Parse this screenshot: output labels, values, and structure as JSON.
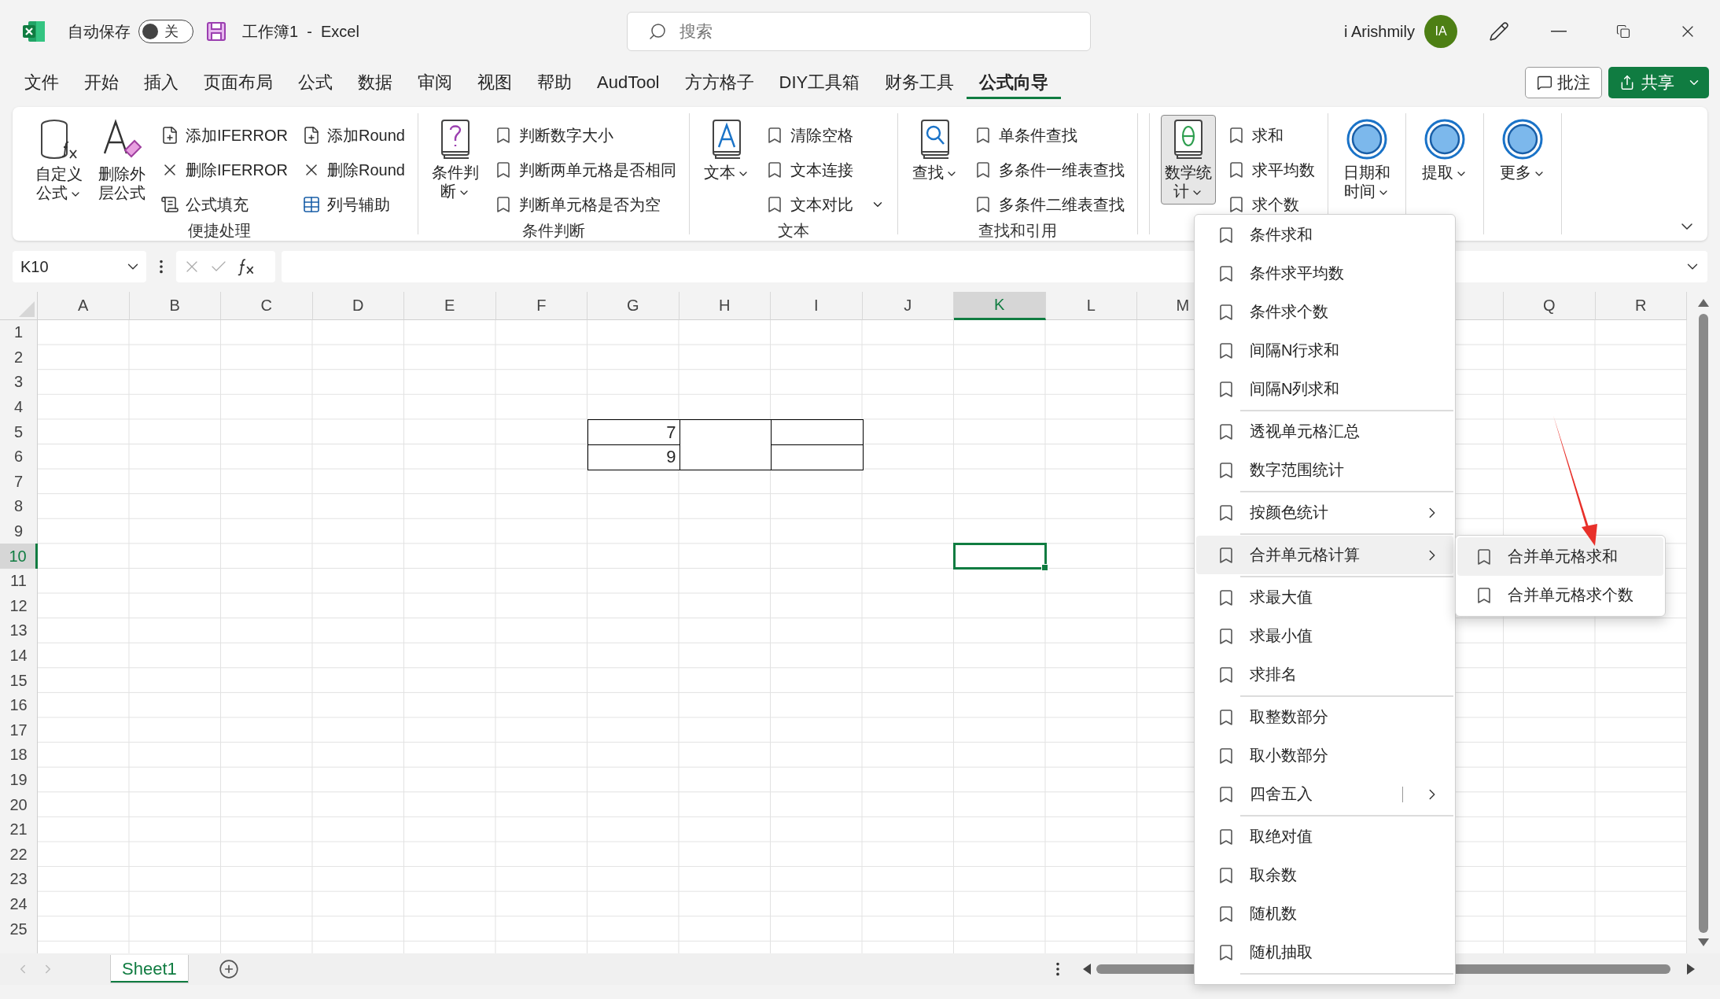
{
  "title_bar": {
    "autosave_label": "自动保存",
    "autosave_toggle": {
      "on": false,
      "label": "关"
    },
    "document_title": "工作簿1  -  Excel",
    "search": {
      "placeholder": "搜索"
    },
    "user_name": "i Arishmily",
    "avatar": "IA"
  },
  "menu_tabs": [
    {
      "label": "文件",
      "selected": false
    },
    {
      "label": "开始",
      "selected": false
    },
    {
      "label": "插入",
      "selected": false
    },
    {
      "label": "页面布局",
      "selected": false
    },
    {
      "label": "公式",
      "selected": false
    },
    {
      "label": "数据",
      "selected": false
    },
    {
      "label": "审阅",
      "selected": false
    },
    {
      "label": "视图",
      "selected": false
    },
    {
      "label": "帮助",
      "selected": false
    },
    {
      "label": "AudTool",
      "selected": false
    },
    {
      "label": "方方格子",
      "selected": false
    },
    {
      "label": "DIY工具箱",
      "selected": false
    },
    {
      "label": "财务工具",
      "selected": false
    },
    {
      "label": "公式向导",
      "selected": true
    }
  ],
  "comments_button": "批注",
  "share_button": "共享",
  "ribbon": {
    "groups": [
      {
        "label": "便捷处理",
        "large_buttons": [
          {
            "label": "自定义公式",
            "dropdown": true,
            "pressed": false
          },
          {
            "label": "删除外层公式",
            "dropdown": false,
            "pressed": false
          }
        ],
        "columns": [
          [
            {
              "label": "添加IFERROR",
              "dropdown": false
            },
            {
              "label": "删除IFERROR",
              "dropdown": false
            },
            {
              "label": "公式填充",
              "dropdown": false
            }
          ],
          [
            {
              "label": "添加Round",
              "dropdown": false
            },
            {
              "label": "删除Round",
              "dropdown": false
            },
            {
              "label": "列号辅助",
              "dropdown": false
            }
          ]
        ]
      },
      {
        "label": "条件判断",
        "large_buttons": [
          {
            "label": "条件判断",
            "dropdown": true,
            "pressed": false
          }
        ],
        "columns": [
          [
            {
              "label": "判断数字大小",
              "dropdown": false
            },
            {
              "label": "判断两单元格是否相同",
              "dropdown": false
            },
            {
              "label": "判断单元格是否为空",
              "dropdown": false
            }
          ]
        ]
      },
      {
        "label": "文本",
        "large_buttons": [
          {
            "label": "文本",
            "dropdown": true,
            "pressed": false
          }
        ],
        "columns": [
          [
            {
              "label": "清除空格",
              "dropdown": false
            },
            {
              "label": "文本连接",
              "dropdown": false
            },
            {
              "label": "文本对比",
              "dropdown": true
            }
          ]
        ]
      },
      {
        "label": "查找和引用",
        "large_buttons": [
          {
            "label": "查找",
            "dropdown": true,
            "pressed": false
          }
        ],
        "columns": [
          [
            {
              "label": "单条件查找",
              "dropdown": false
            },
            {
              "label": "多条件一维表查找",
              "dropdown": false
            },
            {
              "label": "多条件二维表查找",
              "dropdown": false
            }
          ]
        ]
      },
      {
        "large_buttons": [
          {
            "label": "数学统计",
            "dropdown": true,
            "pressed": true
          }
        ],
        "columns": [
          [
            {
              "label": "求和",
              "dropdown": false
            },
            {
              "label": "求平均数",
              "dropdown": false
            },
            {
              "label": "求个数",
              "dropdown": false
            }
          ]
        ]
      },
      {
        "large_buttons": [
          {
            "label": "日期和时间",
            "dropdown": true,
            "pressed": false
          }
        ]
      },
      {
        "large_buttons": [
          {
            "label": "提取",
            "dropdown": true,
            "pressed": false
          }
        ]
      },
      {
        "large_buttons": [
          {
            "label": "更多",
            "dropdown": true,
            "pressed": false
          }
        ]
      }
    ]
  },
  "formula_bar": {
    "name_box": "K10"
  },
  "grid": {
    "columns": [
      {
        "label": "A",
        "selected": false
      },
      {
        "label": "B",
        "selected": false
      },
      {
        "label": "C",
        "selected": false
      },
      {
        "label": "D",
        "selected": false
      },
      {
        "label": "E",
        "selected": false
      },
      {
        "label": "F",
        "selected": false
      },
      {
        "label": "G",
        "selected": false
      },
      {
        "label": "H",
        "selected": false
      },
      {
        "label": "I",
        "selected": false
      },
      {
        "label": "J",
        "selected": false
      },
      {
        "label": "K",
        "selected": true
      },
      {
        "label": "L",
        "selected": false
      },
      {
        "label": "M",
        "selected": false
      },
      null,
      null,
      {
        "selected": false
      },
      {
        "label": "Q",
        "selected": false
      },
      {
        "label": "R",
        "selected": false
      }
    ],
    "rows": [
      {
        "label": "1",
        "selected": false
      },
      {
        "label": "2",
        "selected": false
      },
      {
        "label": "3",
        "selected": false
      },
      {
        "label": "4",
        "selected": false
      },
      {
        "label": "5",
        "selected": false
      },
      {
        "label": "6",
        "selected": false
      },
      {
        "label": "7",
        "selected": false
      },
      {
        "label": "8",
        "selected": false
      },
      {
        "label": "9",
        "selected": false
      },
      {
        "label": "10",
        "selected": true
      },
      {
        "label": "11",
        "selected": false
      },
      {
        "label": "12",
        "selected": false
      },
      {
        "label": "13",
        "selected": false
      },
      {
        "label": "14",
        "selected": false
      },
      {
        "label": "15",
        "selected": false
      },
      {
        "label": "16",
        "selected": false
      },
      {
        "label": "17",
        "selected": false
      },
      {
        "label": "18",
        "selected": false
      },
      {
        "label": "19",
        "selected": false
      },
      {
        "label": "20",
        "selected": false
      },
      {
        "label": "21",
        "selected": false
      },
      {
        "label": "22",
        "selected": false
      },
      {
        "label": "23",
        "selected": false
      },
      {
        "label": "24",
        "selected": false
      },
      {
        "label": "25",
        "selected": false
      }
    ],
    "bordered_block": [
      {
        "cells": [
          {
            "kind": "value",
            "value": "7"
          },
          {
            "kind": "merged"
          },
          {
            "kind": "empty"
          }
        ]
      },
      {
        "cells": [
          {
            "kind": "value",
            "value": "9"
          },
          {
            "kind": "empty"
          }
        ]
      }
    ]
  },
  "sheet_tabs": [
    {
      "label": "Sheet1",
      "selected": true
    }
  ],
  "dropdown_menu": {
    "groups": [
      [
        {
          "label": "条件求和",
          "kind": "plain",
          "selected": false
        },
        {
          "label": "条件求平均数",
          "kind": "plain",
          "selected": false
        },
        {
          "label": "条件求个数",
          "kind": "plain",
          "selected": false
        },
        {
          "label": "间隔N行求和",
          "kind": "plain",
          "selected": false
        },
        {
          "label": "间隔N列求和",
          "kind": "plain",
          "selected": false
        }
      ],
      [
        {
          "label": "透视单元格汇总",
          "kind": "plain",
          "selected": false
        },
        {
          "label": "数字范围统计",
          "kind": "plain",
          "selected": false
        }
      ],
      [
        {
          "label": "按颜色统计",
          "kind": "submenu",
          "selected": false
        }
      ],
      [
        {
          "label": "合并单元格计算",
          "kind": "submenu",
          "selected": true
        }
      ],
      [
        {
          "label": "求最大值",
          "kind": "plain",
          "selected": false
        },
        {
          "label": "求最小值",
          "kind": "plain",
          "selected": false
        },
        {
          "label": "求排名",
          "kind": "plain",
          "selected": false
        }
      ],
      [
        {
          "label": "取整数部分",
          "kind": "plain",
          "selected": false
        },
        {
          "label": "取小数部分",
          "kind": "plain",
          "selected": false
        },
        {
          "label": "四舍五入",
          "kind": "split",
          "selected": false
        }
      ],
      [
        {
          "label": "取绝对值",
          "kind": "plain",
          "selected": false
        },
        {
          "label": "取余数",
          "kind": "plain",
          "selected": false
        },
        {
          "label": "随机数",
          "kind": "plain",
          "selected": false
        },
        {
          "label": "随机抽取",
          "kind": "plain",
          "selected": false
        }
      ]
    ]
  },
  "submenu": {
    "items": [
      {
        "label": "合并单元格求和",
        "selected": true
      },
      {
        "label": "合并单元格求个数",
        "selected": false
      }
    ]
  }
}
